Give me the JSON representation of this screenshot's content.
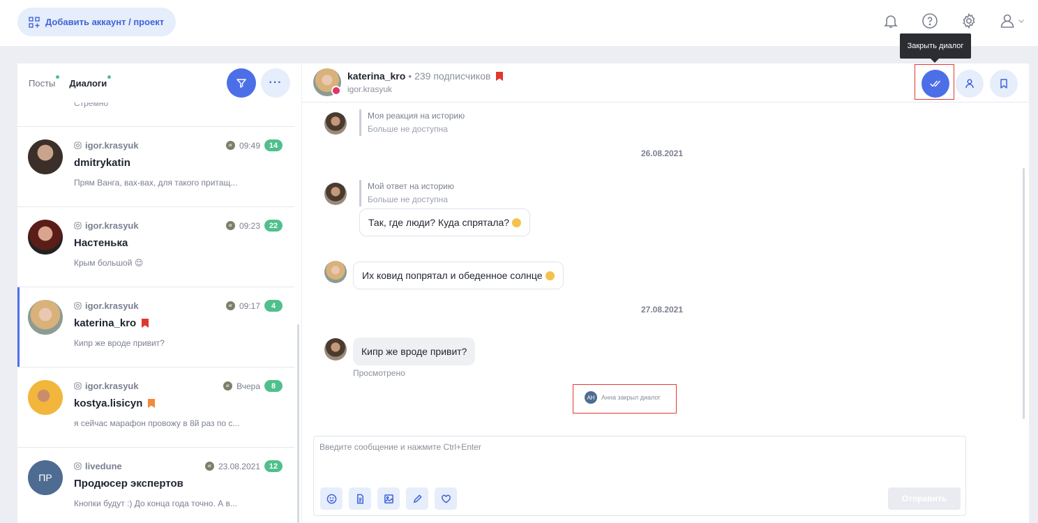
{
  "topbar": {
    "add_account_label": "Добавить аккаунт / проект",
    "icons": [
      "bell-icon",
      "help-icon",
      "gear-icon",
      "user-icon",
      "chevron-down-icon"
    ]
  },
  "tooltip": {
    "text": "Закрыть диалог"
  },
  "left": {
    "tabs": [
      {
        "label": "Посты"
      },
      {
        "label": "Диалоги"
      }
    ],
    "top_cut_text": "Стремно",
    "items": [
      {
        "account": "igor.krasyuk",
        "source": "иг",
        "time": "09:49",
        "count": "14",
        "name": "dmitrykatin",
        "preview": "Прям Ванга, вах-вах, для такого притащ...",
        "flag": ""
      },
      {
        "account": "igor.krasyuk",
        "source": "иг",
        "time": "09:23",
        "count": "22",
        "name": "Настенька",
        "preview": "Крым большой 😌",
        "flag": ""
      },
      {
        "account": "igor.krasyuk",
        "source": "иг",
        "time": "09:17",
        "count": "4",
        "name": "katerina_kro",
        "preview": "Кипр же вроде привит?",
        "flag": "#e0382e"
      },
      {
        "account": "igor.krasyuk",
        "source": "иг",
        "time": "Вчера",
        "count": "8",
        "name": "kostya.lisicyn",
        "preview": "я сейчас марафон провожу в 8й раз по с...",
        "flag": "#f08a3c"
      },
      {
        "account": "livedune",
        "source": "иг",
        "time": "23.08.2021",
        "count": "12",
        "name": "Продюсер экспертов",
        "preview": "Кнопки будут :) До конца года точно. А в...",
        "flag": "",
        "initials": "ПР"
      }
    ]
  },
  "chat": {
    "name": "katerina_kro",
    "subscribers": "• 239 подписчиков",
    "account": "igor.krasyuk",
    "messages": {
      "q1_title": "Моя реакция на историю",
      "q1_sub": "Больше не доступна",
      "date1": "26.08.2021",
      "q2_title": "Мой ответ на историю",
      "q2_sub": "Больше не доступна",
      "b1": "Так, где люди? Куда спрятала?",
      "b2": "Их ковид попрятал и обеденное солнце",
      "date2": "27.08.2021",
      "b3": "Кипр же вроде привит?",
      "seen": "Просмотрено",
      "system_initials": "АН",
      "system_text": "Анна закрыл диалог"
    },
    "compose": {
      "placeholder": "Введите сообщение и нажмите Ctrl+Enter",
      "send_label": "Отправить",
      "tools": [
        "emoji-icon",
        "document-icon",
        "image-icon",
        "pencil-icon",
        "heart-icon"
      ]
    }
  },
  "colors": {
    "accent": "#4c6fe8",
    "badge": "#4fc08d",
    "highlight": "#e0382e"
  }
}
